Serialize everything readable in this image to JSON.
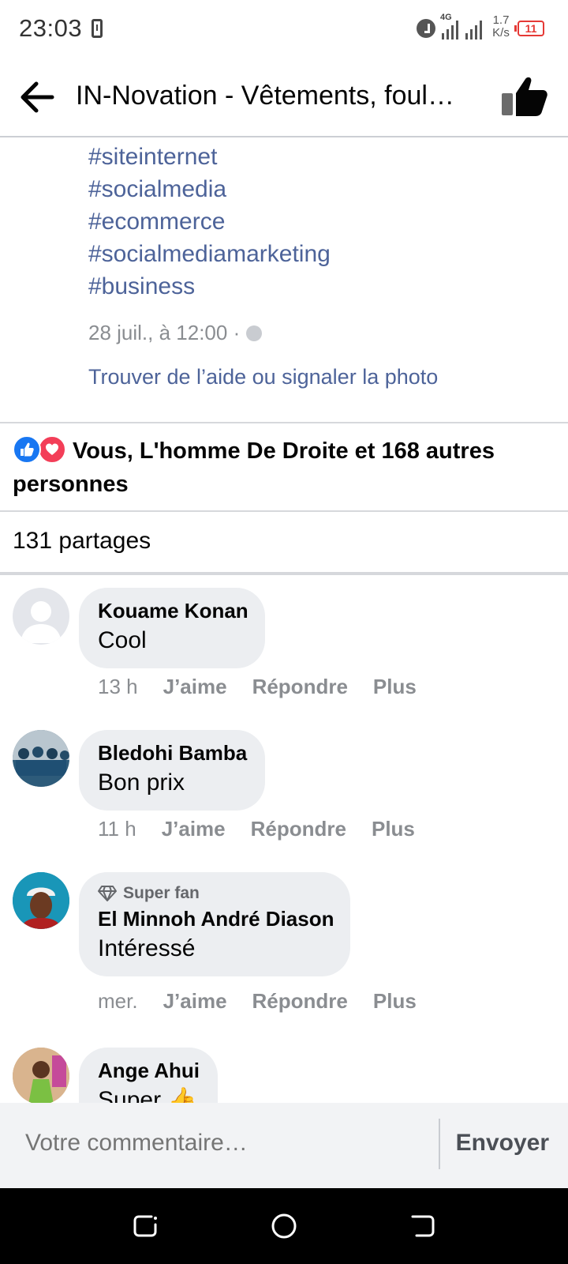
{
  "status_bar": {
    "time": "23:03",
    "network": "4G",
    "speed_value": "1.7",
    "speed_unit": "K/s",
    "battery": "11"
  },
  "header": {
    "title": "IN-Novation - Vêtements, foul…",
    "back_icon": "arrow-left-icon",
    "like_icon": "thumbs-up-icon"
  },
  "post": {
    "hashtags": [
      "#siteinternet",
      "#socialmedia",
      "#ecommerce",
      "#socialmediamarketing",
      "#business"
    ],
    "date": "28 juil., à 12:00 ·",
    "help_link": "Trouver de l’aide ou signaler la photo"
  },
  "reactions": {
    "text": "Vous, L'homme De Droite et 168 autres personnes",
    "icons": [
      "like-reaction-icon",
      "love-reaction-icon"
    ],
    "like_color": "#1877f2",
    "love_color": "#f33e58"
  },
  "shares": "131 partages",
  "comments": [
    {
      "name": "Kouame Konan",
      "text": "Cool",
      "time": "13 h",
      "badge": ""
    },
    {
      "name": "Bledohi Bamba",
      "text": "Bon prix",
      "time": "11 h",
      "badge": ""
    },
    {
      "name": "El Minnoh André Diason",
      "text": "Intéressé",
      "time": "mer.",
      "badge": "Super fan"
    },
    {
      "name": "Ange Ahui",
      "text": "Super 👍",
      "time": "",
      "badge": ""
    }
  ],
  "comment_actions": {
    "like": "J’aime",
    "reply": "Répondre",
    "more": "Plus"
  },
  "composer": {
    "placeholder": "Votre commentaire…",
    "send_label": "Envoyer"
  },
  "colors": {
    "link": "#4d6399",
    "bubble": "#eceef1",
    "muted": "#8a8d91"
  }
}
